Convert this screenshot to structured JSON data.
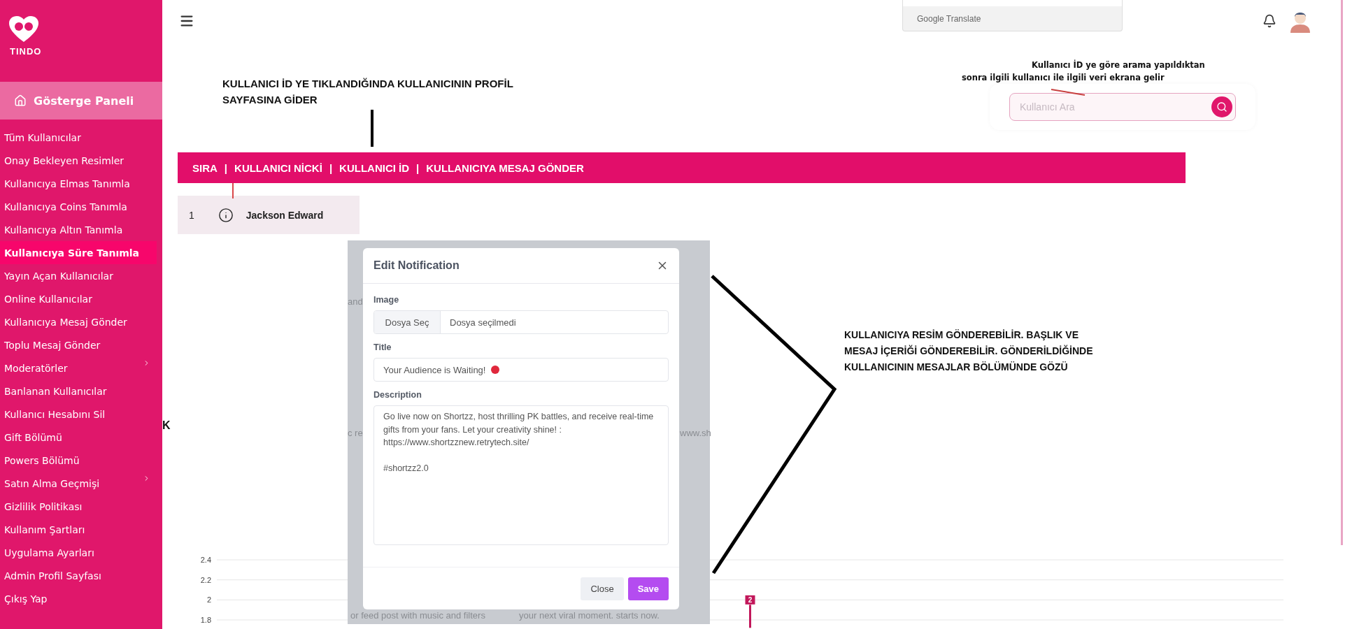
{
  "sidebar": {
    "brand": "TINDO",
    "dashboard": {
      "label": "Gösterge Paneli",
      "selected": true
    },
    "items": [
      {
        "label": "Tüm Kullanıcılar",
        "selected": false,
        "has_submenu": false
      },
      {
        "label": "Onay Bekleyen Resimler",
        "selected": false,
        "has_submenu": false
      },
      {
        "label": "Kullanıcıya Elmas Tanımla",
        "selected": false,
        "has_submenu": false
      },
      {
        "label": "Kullanıcıya Coins Tanımla",
        "selected": false,
        "has_submenu": false
      },
      {
        "label": "Kullanıcıya Altın Tanımla",
        "selected": false,
        "has_submenu": false
      },
      {
        "label": "Kullanıcıya Süre Tanımla",
        "selected": true,
        "has_submenu": false
      },
      {
        "label": "Yayın Açan Kullanıcılar",
        "selected": false,
        "has_submenu": false
      },
      {
        "label": "Online Kullanıcılar",
        "selected": false,
        "has_submenu": false
      },
      {
        "label": "Kullanıcıya Mesaj Gönder",
        "selected": false,
        "has_submenu": false
      },
      {
        "label": "Toplu Mesaj Gönder",
        "selected": false,
        "has_submenu": false
      },
      {
        "label": "Moderatörler",
        "selected": false,
        "has_submenu": true
      },
      {
        "label": "Banlanan Kullanıcılar",
        "selected": false,
        "has_submenu": false
      },
      {
        "label": "Kullanıcı Hesabını Sil",
        "selected": false,
        "has_submenu": false
      },
      {
        "label": "Gift Bölümü",
        "selected": false,
        "has_submenu": false
      },
      {
        "label": "Powers Bölümü",
        "selected": false,
        "has_submenu": false
      },
      {
        "label": "Satın Alma Geçmişi",
        "selected": false,
        "has_submenu": true
      },
      {
        "label": "Gizlilik Politikası",
        "selected": false,
        "has_submenu": false
      },
      {
        "label": "Kullanım Şartları",
        "selected": false,
        "has_submenu": false
      },
      {
        "label": "Uygulama Ayarları",
        "selected": false,
        "has_submenu": false
      },
      {
        "label": "Admin Profil Sayfası",
        "selected": false,
        "has_submenu": false
      },
      {
        "label": "Çıkış Yap",
        "selected": false,
        "has_submenu": false
      }
    ]
  },
  "translate_widget": {
    "label": "Google Translate"
  },
  "notes": {
    "profile_link": "KULLANICI İD YE TIKLANDIĞINDA KULLANICININ PROFİL SAYFASINA GİDER",
    "search": "Kullanıcı İD ye göre arama yapıldıktan sonra ilgili kullanıcı ile ilgili veri ekrana gelir",
    "message": "KULLANICIYA RESİM GÖNDEREBİLİR. BAŞLIK VE MESAJ İÇERİĞİ GÖNDEREBİLİR. GÖNDERİLDİĞİNDE KULLANICININ MESAJLAR BÖLÜMÜNDE GÖZÜ"
  },
  "search": {
    "placeholder": "Kullanıcı Ara"
  },
  "table": {
    "separator": "|",
    "columns": [
      "SIRA",
      "KULLANICI NİCKİ",
      "KULLANICI İD",
      "KULLANICIYA MESAJ GÖNDER"
    ],
    "rows": [
      {
        "index": "1",
        "name": "Jackson Edward"
      }
    ]
  },
  "cut_heading": "K",
  "background_fragments": {
    "left_top": "and",
    "left_bottom": "c re",
    "right_bottom": "www.sh",
    "bottom_left": "or feed post with music and filters",
    "bottom_right": "your next viral moment. starts now."
  },
  "modal": {
    "title": "Edit Notification",
    "image": {
      "label": "Image",
      "button": "Dosya Seç",
      "value": "Dosya seçilmedi"
    },
    "title_field": {
      "label": "Title",
      "value": "Your Audience is Waiting!"
    },
    "description": {
      "label": "Description",
      "value": "Go live now on Shortzz, host thrilling PK battles, and receive real-time gifts from your fans. Let your creativity shine! : https://www.shortzznew.retrytech.site/\n\n#shortzz2.0"
    },
    "buttons": [
      "Close",
      "Save"
    ]
  },
  "chart": {
    "chart_data": {
      "type": "line",
      "ylim": [
        1.8,
        2.4
      ],
      "yticks": [
        {
          "value": 2.4,
          "label": "2.4"
        },
        {
          "value": 2.2,
          "label": "2.2"
        },
        {
          "value": 2,
          "label": "2"
        },
        {
          "value": 1.8,
          "label": "1.8"
        }
      ],
      "series": [
        {
          "color": "#c2185b",
          "marker": "square",
          "values": [
            2
          ]
        }
      ],
      "data_labels": true
    }
  }
}
